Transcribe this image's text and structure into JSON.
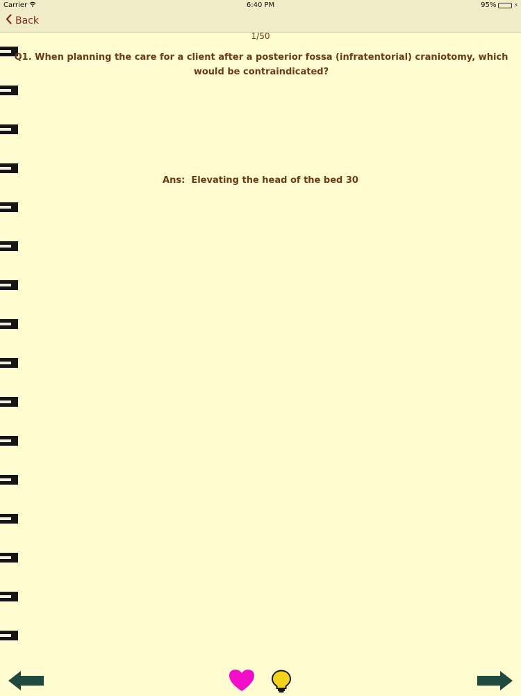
{
  "status_bar": {
    "carrier": "Carrier",
    "time": "6:40 PM",
    "battery": "95%"
  },
  "nav": {
    "back_label": "Back"
  },
  "card": {
    "counter": "1/50",
    "question": "Q1. When planning the care for a client after a posterior fossa (infratentorial) craniotomy, which would be contraindicated?",
    "answer": "Ans:  Elevating the head of the bed 30"
  },
  "toolbar": {
    "prev_icon": "arrow-left-icon",
    "favorite_icon": "heart-icon",
    "hint_icon": "lightbulb-icon",
    "next_icon": "arrow-right-icon"
  },
  "colors": {
    "background": "#fefcd0",
    "text": "#6b3a16",
    "back_link": "#8a2a16",
    "arrow": "#1f4a3d",
    "heart": "#f20ec8",
    "bulb": "#f5d21c"
  }
}
